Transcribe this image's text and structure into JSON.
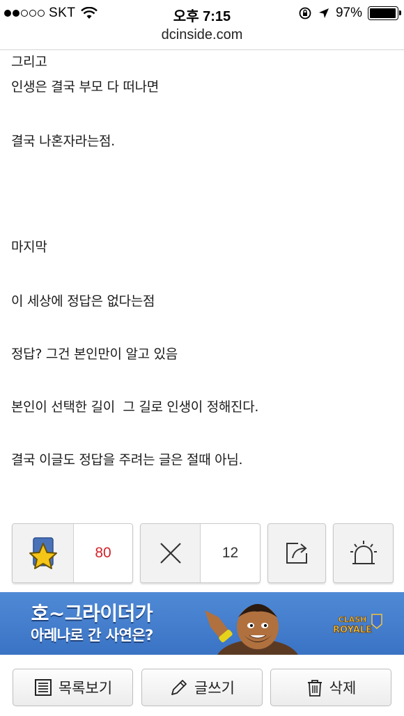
{
  "status_bar": {
    "carrier": "SKT",
    "time": "오후 7:15",
    "battery": "97%",
    "battery_level": 0.97,
    "signal_bars_filled": 2,
    "signal_bars_total": 5
  },
  "browser": {
    "url": "dcinside.com"
  },
  "article": {
    "lines": [
      "그리고",
      "인생은 결국 부모 다 떠나면",
      "결국 나혼자라는점.",
      "마지막",
      "이 세상에 정답은 없다는점",
      "정답? 그건 본인만이 알고 있음",
      "본인이 선택한 길이  그 길로 인생이 정해진다.",
      "결국 이글도 정답을 주려는 글은 절때 아님."
    ]
  },
  "actions": {
    "recommend_count": "80",
    "downvote_count": "12",
    "colors": {
      "recommend_count": "#d1232a",
      "star": "#f5c518",
      "star_box": "#4a72b8"
    }
  },
  "banner": {
    "line1": "호~그라이더가",
    "line2": "아레나로 간 사연은?",
    "brand": "CLASH ROYALE",
    "background": "#3f7ccb"
  },
  "bottom_bar": {
    "list_label": "목록보기",
    "write_label": "글쓰기",
    "delete_label": "삭제"
  }
}
